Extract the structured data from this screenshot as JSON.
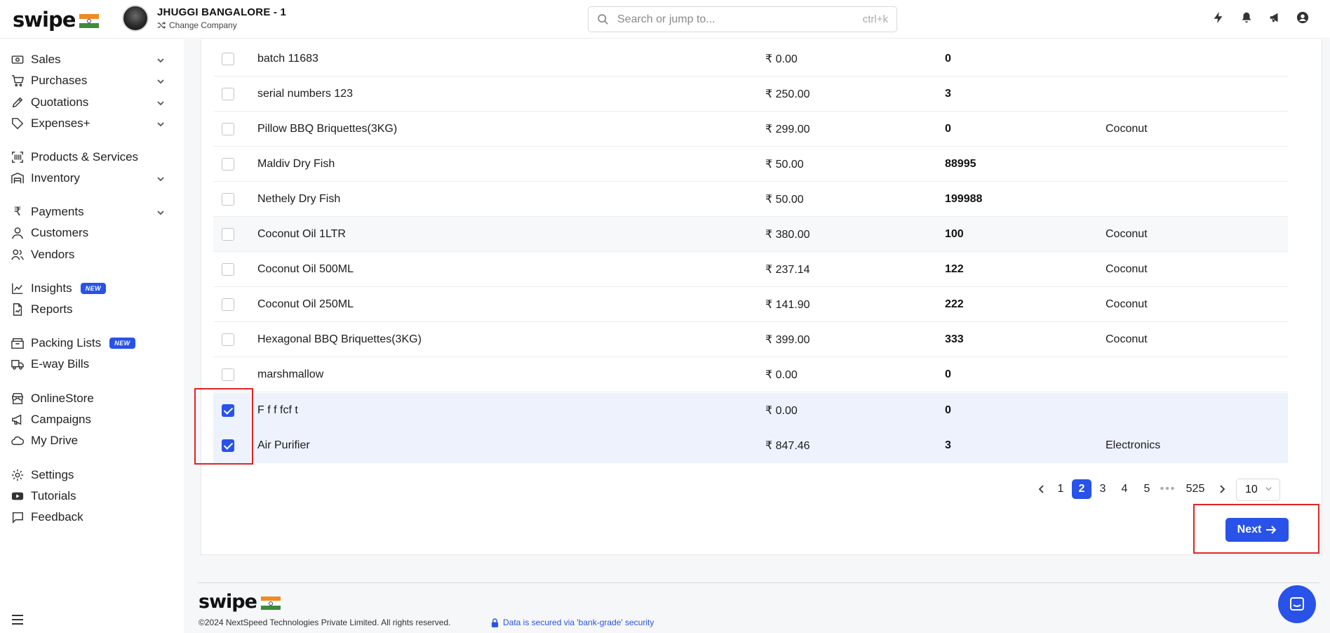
{
  "app": {
    "logo_text": "swipe",
    "company_name": "JHUGGI BANGALORE - 1",
    "change_company": "Change Company",
    "search_placeholder": "Search or jump to...",
    "search_shortcut": "ctrl+k",
    "top_icons": [
      "lightning-icon",
      "bell-icon",
      "megaphone-icon",
      "user-circle-icon"
    ]
  },
  "sidebar": {
    "items": [
      {
        "label": "Sales",
        "icon": "cash-icon",
        "has_chevron": true
      },
      {
        "label": "Purchases",
        "icon": "cart-icon",
        "has_chevron": true
      },
      {
        "label": "Quotations",
        "icon": "pencil-icon",
        "has_chevron": true
      },
      {
        "label": "Expenses+",
        "icon": "tag-icon",
        "has_chevron": true
      },
      {
        "label": "Products & Services",
        "icon": "barcode-icon",
        "has_chevron": false
      },
      {
        "label": "Inventory",
        "icon": "warehouse-icon",
        "has_chevron": true
      },
      {
        "label": "Payments",
        "icon": "rupee-icon",
        "has_chevron": true
      },
      {
        "label": "Customers",
        "icon": "user-icon",
        "has_chevron": false
      },
      {
        "label": "Vendors",
        "icon": "users-icon",
        "has_chevron": false
      },
      {
        "label": "Insights",
        "icon": "chart-icon",
        "badge": "NEW"
      },
      {
        "label": "Reports",
        "icon": "report-icon",
        "has_chevron": false
      },
      {
        "label": "Packing Lists",
        "icon": "package-icon",
        "badge": "NEW"
      },
      {
        "label": "E-way Bills",
        "icon": "truck-icon",
        "has_chevron": false
      },
      {
        "label": "OnlineStore",
        "icon": "store-icon",
        "has_chevron": false
      },
      {
        "label": "Campaigns",
        "icon": "megaphone-icon",
        "has_chevron": false
      },
      {
        "label": "My Drive",
        "icon": "cloud-icon",
        "has_chevron": false
      },
      {
        "label": "Settings",
        "icon": "gear-icon",
        "has_chevron": false
      },
      {
        "label": "Tutorials",
        "icon": "youtube-icon",
        "has_chevron": false
      },
      {
        "label": "Feedback",
        "icon": "message-icon",
        "has_chevron": false
      }
    ]
  },
  "table": {
    "rows": [
      {
        "name": "batch 11683",
        "price": "₹ 0.00",
        "qty": "0",
        "category": "",
        "checked": false
      },
      {
        "name": "serial numbers 123",
        "price": "₹ 250.00",
        "qty": "3",
        "category": "",
        "checked": false
      },
      {
        "name": "Pillow BBQ Briquettes(3KG)",
        "price": "₹ 299.00",
        "qty": "0",
        "category": "Coconut",
        "checked": false
      },
      {
        "name": "Maldiv Dry Fish",
        "price": "₹ 50.00",
        "qty": "88995",
        "category": "",
        "checked": false
      },
      {
        "name": "Nethely Dry Fish",
        "price": "₹ 50.00",
        "qty": "199988",
        "category": "",
        "checked": false
      },
      {
        "name": "Coconut Oil 1LTR",
        "price": "₹ 380.00",
        "qty": "100",
        "category": "Coconut",
        "checked": false
      },
      {
        "name": "Coconut Oil 500ML",
        "price": "₹ 237.14",
        "qty": "122",
        "category": "Coconut",
        "checked": false
      },
      {
        "name": "Coconut Oil 250ML",
        "price": "₹ 141.90",
        "qty": "222",
        "category": "Coconut",
        "checked": false
      },
      {
        "name": "Hexagonal BBQ Briquettes(3KG)",
        "price": "₹ 399.00",
        "qty": "333",
        "category": "Coconut",
        "checked": false
      },
      {
        "name": "marshmallow",
        "price": "₹ 0.00",
        "qty": "0",
        "category": "",
        "checked": false
      },
      {
        "name": "F f f fcf t",
        "price": "₹ 0.00",
        "qty": "0",
        "category": "",
        "checked": true
      },
      {
        "name": "Air Purifier",
        "price": "₹ 847.46",
        "qty": "3",
        "category": "Electronics",
        "checked": true
      }
    ]
  },
  "pagination": {
    "pages": [
      "1",
      "2",
      "3",
      "4",
      "5",
      "•••",
      "525"
    ],
    "current": "2",
    "page_size": "10"
  },
  "actions": {
    "next_label": "Next"
  },
  "footer": {
    "logo_text": "swipe",
    "copyright": "©2024 NextSpeed Technologies Private Limited. All rights reserved.",
    "secured": "Data is secured via 'bank-grade' security"
  },
  "colors": {
    "accent": "#2852e8",
    "highlight": "#e02424",
    "selected_row": "#edf2fd"
  }
}
